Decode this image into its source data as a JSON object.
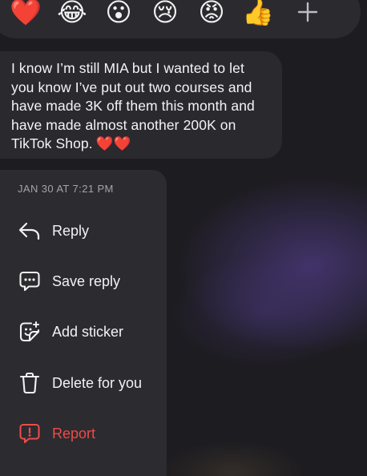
{
  "reactions": [
    {
      "name": "red-heart",
      "glyph": "❤️"
    },
    {
      "name": "face-with-tears-of-joy",
      "glyph": "😂"
    },
    {
      "name": "face-with-open-mouth",
      "glyph": "😮"
    },
    {
      "name": "crying-face",
      "glyph": "😢"
    },
    {
      "name": "angry-face",
      "glyph": "😡"
    },
    {
      "name": "thumbs-up",
      "glyph": "👍"
    },
    {
      "name": "plus",
      "glyph": "+"
    }
  ],
  "message": {
    "text": "I know I’m still MIA but I wanted to let you know I’ve put out two courses and have made 3K off them this month and have made almost another 200K on TikTok Shop.",
    "hearts": "❤️❤️"
  },
  "menu": {
    "timestamp": "JAN 30 AT 7:21 PM",
    "items": [
      {
        "label": "Reply",
        "icon": "reply-arrow-icon"
      },
      {
        "label": "Save reply",
        "icon": "speech-bubble-dots-icon"
      },
      {
        "label": "Add sticker",
        "icon": "sticker-face-icon"
      },
      {
        "label": "Delete for you",
        "icon": "trash-icon"
      },
      {
        "label": "Report",
        "icon": "report-alert-icon"
      }
    ]
  },
  "colors": {
    "background": "#1d1c20",
    "bubble": "#2a292e",
    "menu": "#2c2b30",
    "report": "#ee4b47",
    "muted": "#a4a3a9"
  }
}
